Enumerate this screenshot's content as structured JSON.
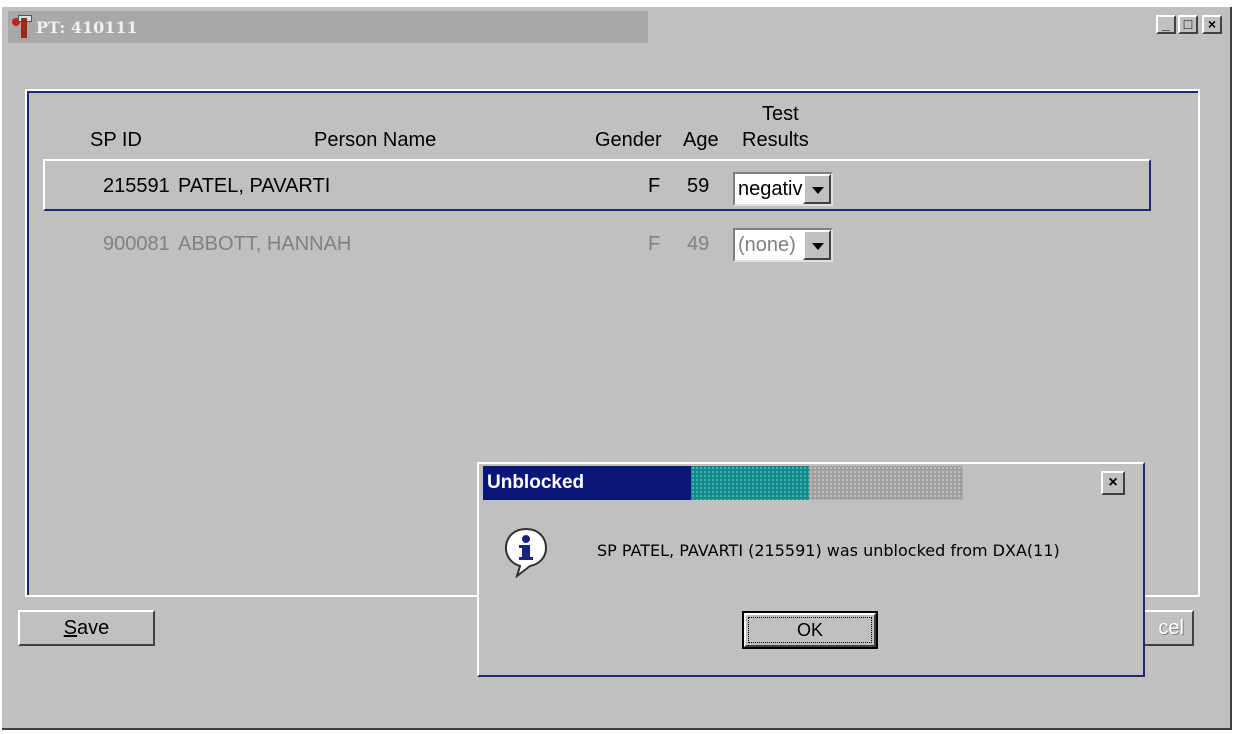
{
  "window": {
    "title": "PT: 410111",
    "controls": {
      "minimize": "_",
      "maximize": "□",
      "close": "×"
    }
  },
  "table": {
    "headers": {
      "sp_id": "SP ID",
      "person_name": "Person Name",
      "gender": "Gender",
      "age": "Age",
      "test": "Test",
      "results": "Results"
    },
    "rows": [
      {
        "sp_id": "215591",
        "name": "PATEL, PAVARTI",
        "gender": "F",
        "age": "59",
        "result": "negative",
        "enabled": true
      },
      {
        "sp_id": "900081",
        "name": "ABBOTT, HANNAH",
        "gender": "F",
        "age": "49",
        "result": "(none)",
        "enabled": false
      }
    ]
  },
  "buttons": {
    "save_prefix": "S",
    "save_rest": "ave",
    "cancel_partial": "cel"
  },
  "dialog": {
    "title": "Unblocked",
    "close": "×",
    "message": "SP PATEL, PAVARTI  (215591) was unblocked from DXA(11)",
    "ok_label": "OK",
    "icon": "info-icon"
  },
  "colors": {
    "window_bg": "#c0c0c0",
    "dialog_title": "#0a1777",
    "disabled_text": "#808080"
  }
}
